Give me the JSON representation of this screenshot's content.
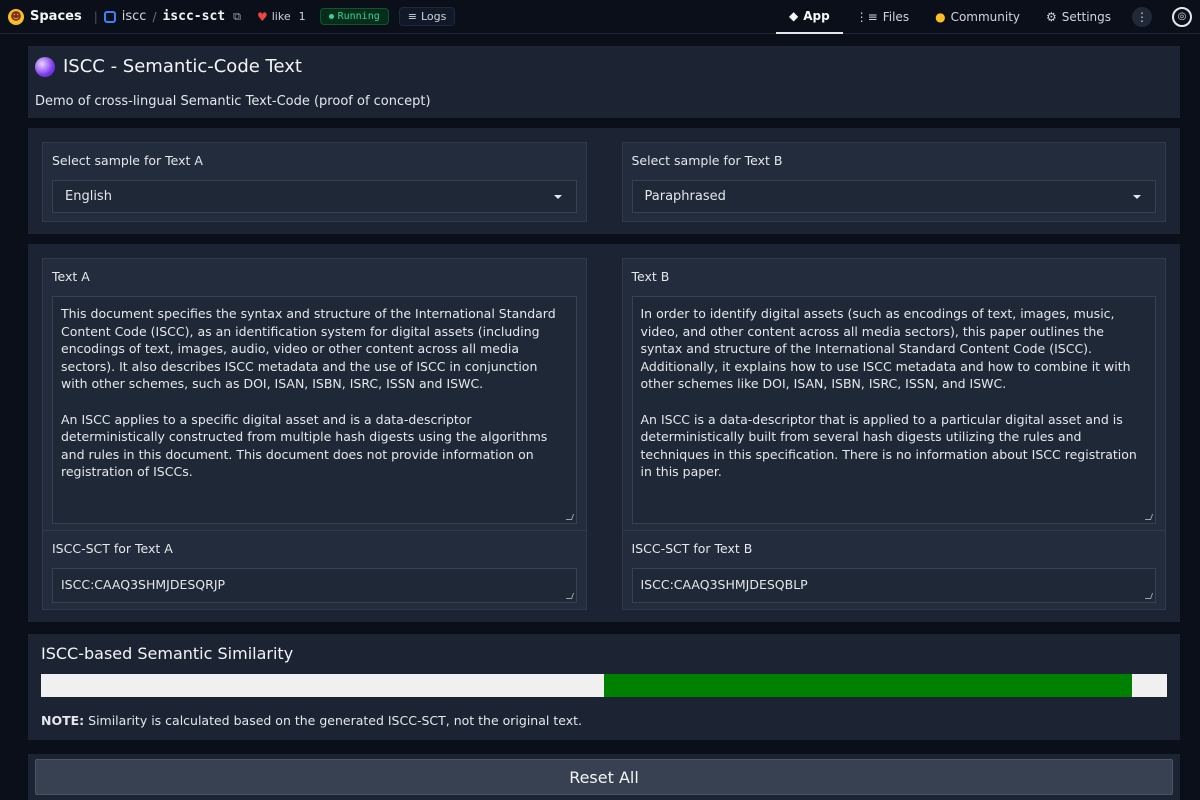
{
  "topbar": {
    "spaces_label": "Spaces",
    "owner": "iscc",
    "slash": "/",
    "repo": "iscc-sct",
    "like_label": "like",
    "like_count": "1",
    "status": "Running",
    "logs_label": "Logs",
    "nav": {
      "app": "App",
      "files": "Files",
      "community": "Community",
      "settings": "Settings"
    }
  },
  "header": {
    "title": "ISCC - Semantic-Code Text",
    "subtitle": "Demo of cross-lingual Semantic Text-Code (proof of concept)"
  },
  "samples": {
    "a": {
      "label": "Select sample for Text A",
      "value": "English"
    },
    "b": {
      "label": "Select sample for Text B",
      "value": "Paraphrased"
    }
  },
  "texts": {
    "a": {
      "label": "Text A",
      "para1": "This document specifies the syntax and structure of the International Standard Content Code (ISCC), as an identification system for digital assets (including encodings of text, images, audio, video or other content across all media sectors). It also describes ISCC metadata and the use of ISCC in conjunction with other schemes, such as DOI, ISAN, ISBN, ISRC, ISSN and ISWC.",
      "para2": "An ISCC applies to a specific digital asset and is a data-descriptor deterministically constructed from multiple hash digests using the algorithms and rules in this document. This document does not provide information on registration of ISCCs.",
      "code_label": "ISCC-SCT for Text A",
      "code": "ISCC:CAAQ3SHMJDESQRJP"
    },
    "b": {
      "label": "Text B",
      "para1": "In order to identify digital assets (such as encodings of text, images, music, video, and other content across all media sectors), this paper outlines the syntax and structure of the International Standard Content Code (ISCC). Additionally, it explains how to use ISCC metadata and how to combine it with other schemes like DOI, ISAN, ISBN, ISRC, ISSN, and ISWC.",
      "para2": "An ISCC is a data-descriptor that is applied to a particular digital asset and is deterministically built from several hash digests utilizing the rules and techniques in this specification. There is no information about ISCC registration in this paper.",
      "code_label": "ISCC-SCT for Text B",
      "code": "ISCC:CAAQ3SHMJDESQBLP"
    }
  },
  "similarity": {
    "title": "ISCC-based Semantic Similarity",
    "value_label": "93.75%",
    "bar_start_fraction": 0.5,
    "bar_end_fraction": 0.96875,
    "bar_color": "#008000",
    "note_bold": "NOTE:",
    "note_text": " Similarity is calculated based on the generated ISCC-SCT, not the original text."
  },
  "reset_label": "Reset All"
}
